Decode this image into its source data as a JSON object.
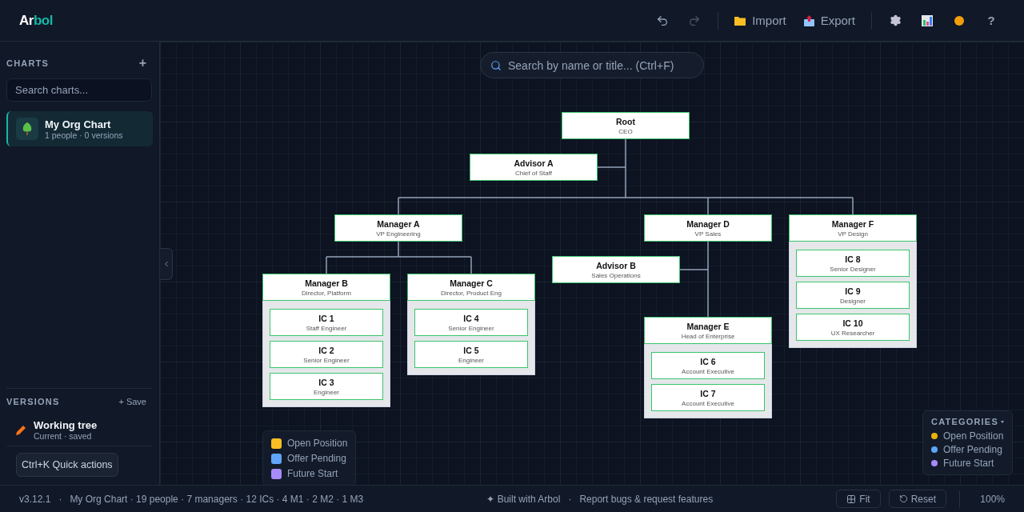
{
  "app": {
    "logo_start": "Ar",
    "logo_end": "bol"
  },
  "toolbar": {
    "undo": {
      "disabled": false
    },
    "redo": {
      "disabled": true
    },
    "buttons": [
      {
        "kind": "import",
        "label": "Import"
      },
      {
        "kind": "export",
        "label": "Export"
      }
    ],
    "help": "?"
  },
  "sidebar": {
    "charts_heading": "CHARTS",
    "add": "+",
    "search": {
      "placeholder": "Search charts..."
    },
    "charts": [
      {
        "name": "My Org Chart",
        "meta": "1 people · 0 versions",
        "selected": true
      }
    ],
    "versions_heading": "VERSIONS",
    "save": "+ Save",
    "versions": [
      {
        "name": "Working tree",
        "meta": "Current · saved"
      }
    ],
    "quick_actions": "Ctrl+K Quick actions"
  },
  "canvas": {
    "search": {
      "placeholder": "Search by name or title... (Ctrl+F)"
    },
    "tree": {
      "name": "Root",
      "title": "CEO",
      "kind": "manager",
      "children": [
        {
          "name": "Advisor A",
          "title": "Chief of Staff",
          "kind": "advisor"
        },
        {
          "name": "Manager A",
          "title": "VP Engineering",
          "kind": "manager",
          "children": [
            {
              "name": "Manager B",
              "title": "Director, Platform",
              "kind": "manager",
              "children": [
                {
                  "name": "IC 1",
                  "title": "Staff Engineer",
                  "kind": "ic"
                },
                {
                  "name": "IC 2",
                  "title": "Senior Engineer",
                  "kind": "ic"
                },
                {
                  "name": "IC 3",
                  "title": "Engineer",
                  "kind": "ic"
                }
              ]
            },
            {
              "name": "Manager C",
              "title": "Director, Product Eng",
              "kind": "manager",
              "children": [
                {
                  "name": "IC 4",
                  "title": "Senior Engineer",
                  "kind": "ic"
                },
                {
                  "name": "IC 5",
                  "title": "Engineer",
                  "kind": "ic"
                }
              ]
            }
          ]
        },
        {
          "name": "Manager D",
          "title": "VP Sales",
          "kind": "manager",
          "children": [
            {
              "name": "Advisor B",
              "title": "Sales Operations",
              "kind": "advisor"
            },
            {
              "name": "Manager E",
              "title": "Head of Enterprise",
              "kind": "manager",
              "children": [
                {
                  "name": "IC 6",
                  "title": "Account Executive",
                  "kind": "ic"
                },
                {
                  "name": "IC 7",
                  "title": "Account Executive",
                  "kind": "ic"
                }
              ]
            }
          ]
        },
        {
          "name": "Manager F",
          "title": "VP Design",
          "kind": "manager",
          "children": [
            {
              "name": "IC 8",
              "title": "Senior Designer",
              "kind": "ic"
            },
            {
              "name": "IC 9",
              "title": "Designer",
              "kind": "ic"
            },
            {
              "name": "IC 10",
              "title": "UX Researcher",
              "kind": "ic"
            }
          ]
        }
      ]
    },
    "legend": [
      {
        "label": "Open Position",
        "color": "#fbbf24"
      },
      {
        "label": "Offer Pending",
        "color": "#60a5fa"
      },
      {
        "label": "Future Start",
        "color": "#a78bfa"
      }
    ],
    "categories": {
      "title": "CATEGORIES",
      "items": [
        {
          "label": "Open Position",
          "color": "#eab308"
        },
        {
          "label": "Offer Pending",
          "color": "#60a5fa"
        },
        {
          "label": "Future Start",
          "color": "#a78bfa"
        }
      ]
    }
  },
  "status_bar": {
    "version": "v3.12.1",
    "separator": "·",
    "summary": "My Org Chart · 19 people · 7 managers · 12 ICs · 4 M1 · 2 M2 · 1 M3",
    "built": "✦ Built with Arbol",
    "separator_2": "·",
    "report": "Report bugs & request features",
    "fit": "Fit",
    "reset": "Reset",
    "zoom": "100%"
  }
}
